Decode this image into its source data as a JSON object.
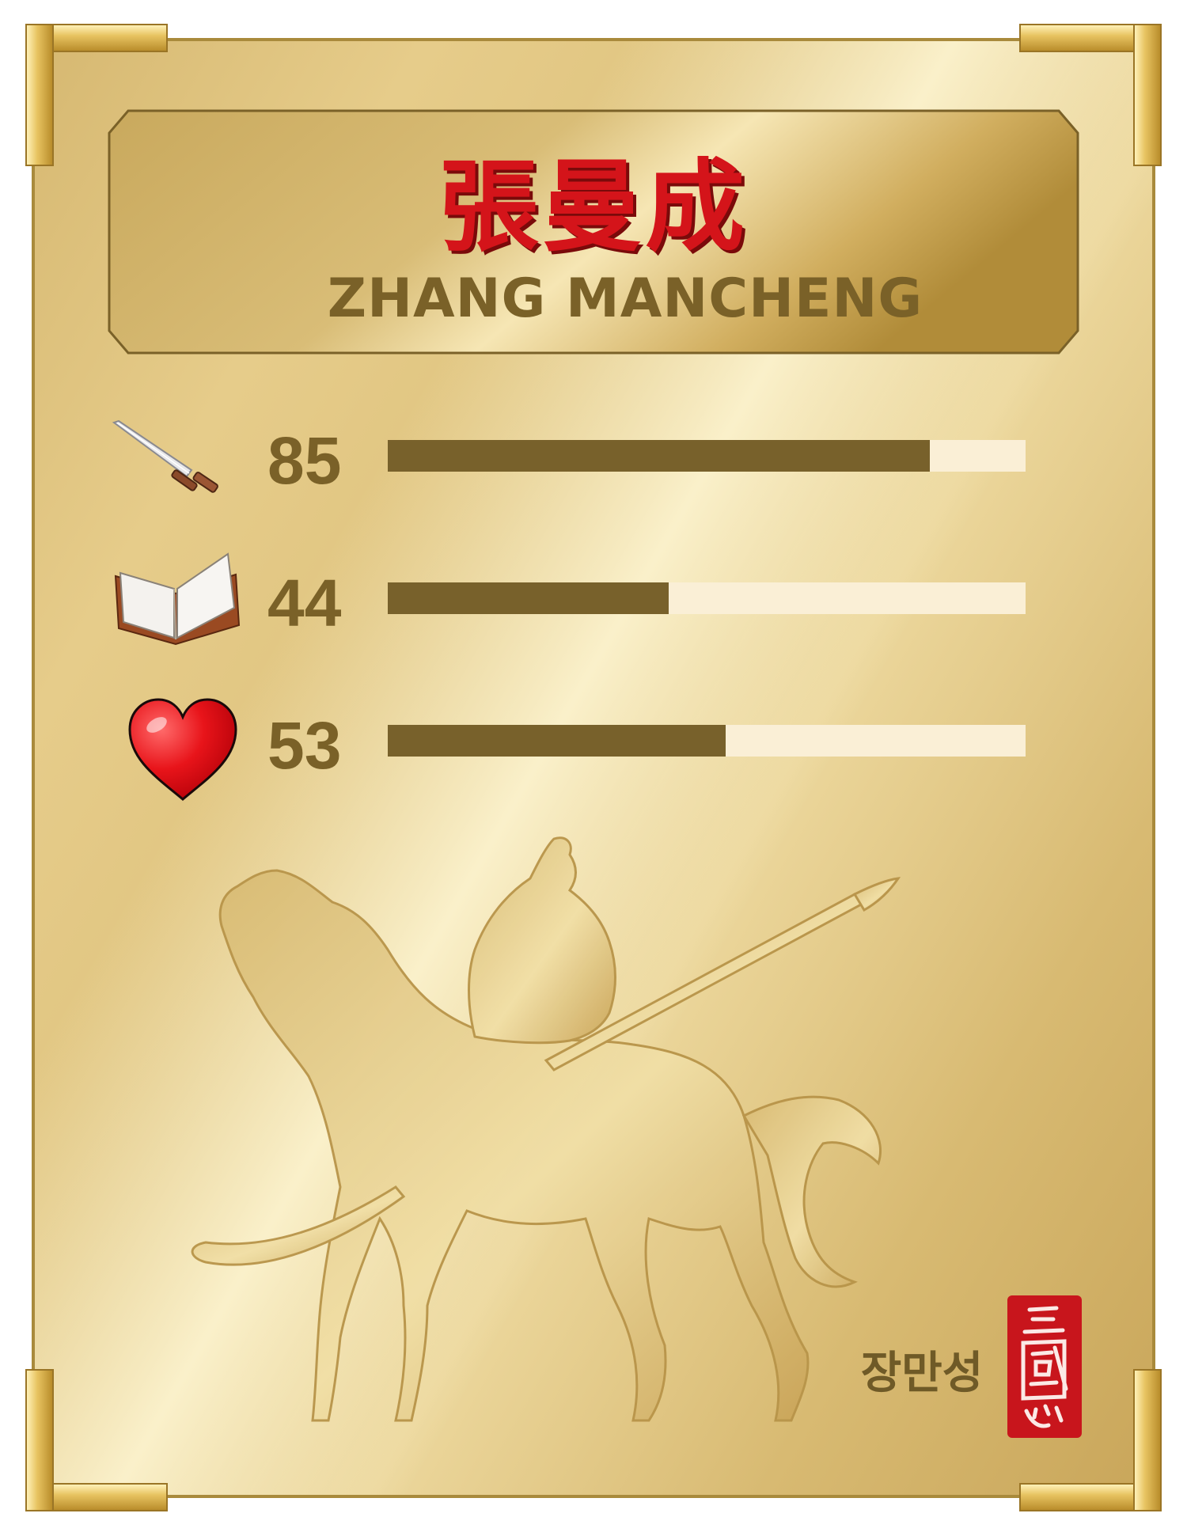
{
  "card": {
    "name_cn": "張曼成",
    "name_en": "ZHANG MANCHENG",
    "name_kr": "장만성",
    "seal_text": "三國志"
  },
  "stats": [
    {
      "icon": "sword-icon",
      "label_value": "85",
      "value": 85,
      "max": 100
    },
    {
      "icon": "book-icon",
      "label_value": "44",
      "value": 44,
      "max": 100
    },
    {
      "icon": "heart-icon",
      "label_value": "53",
      "value": 53,
      "max": 100
    }
  ],
  "colors": {
    "name_red": "#d4141a",
    "text_brown": "#7a6128",
    "bar_fill": "#78612b",
    "bar_track": "#faefd6",
    "seal_red": "#c8151c"
  }
}
